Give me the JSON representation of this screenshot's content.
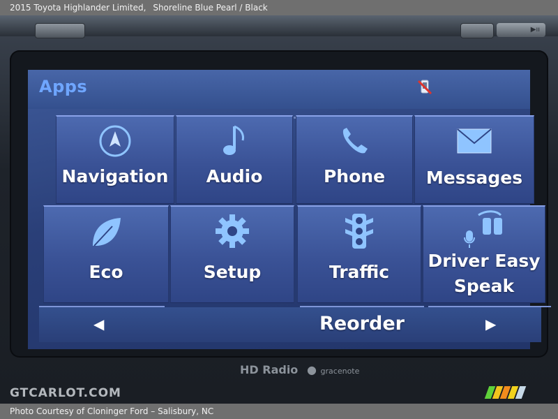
{
  "caption": {
    "vehicle": "2015 Toyota Highlander Limited,",
    "color": "Shoreline Blue Pearl / Black",
    "credit": "Photo Courtesy of Cloninger Ford – Salisbury, NC"
  },
  "screen": {
    "title": "Apps",
    "status_icon": "phone-disconnected-icon",
    "tiles": [
      {
        "label": "Navigation",
        "icon": "compass-icon"
      },
      {
        "label": "Audio",
        "icon": "music-note-icon"
      },
      {
        "label": "Phone",
        "icon": "phone-handset-icon"
      },
      {
        "label": "Messages",
        "icon": "envelope-icon"
      },
      {
        "label": "Eco",
        "icon": "leaf-icon"
      },
      {
        "label": "Setup",
        "icon": "gear-icon"
      },
      {
        "label": "Traffic",
        "icon": "traffic-light-icon"
      },
      {
        "label": "Driver Easy",
        "label2": "Speak",
        "icon": "driver-speak-icon"
      }
    ],
    "bottom": {
      "prev": "◀",
      "reorder": "Reorder",
      "next": "▶"
    }
  },
  "hardware": {
    "hd_radio": "Radio",
    "hd_prefix": "HD",
    "gracenote": "gracenote",
    "play_pause": "▶ıı"
  },
  "watermark": "GTCARLOT.COM",
  "colors": {
    "accent_title": "#6fa6ff",
    "tile_top": "#4d6ab0",
    "icon": "#8fc4ff"
  }
}
